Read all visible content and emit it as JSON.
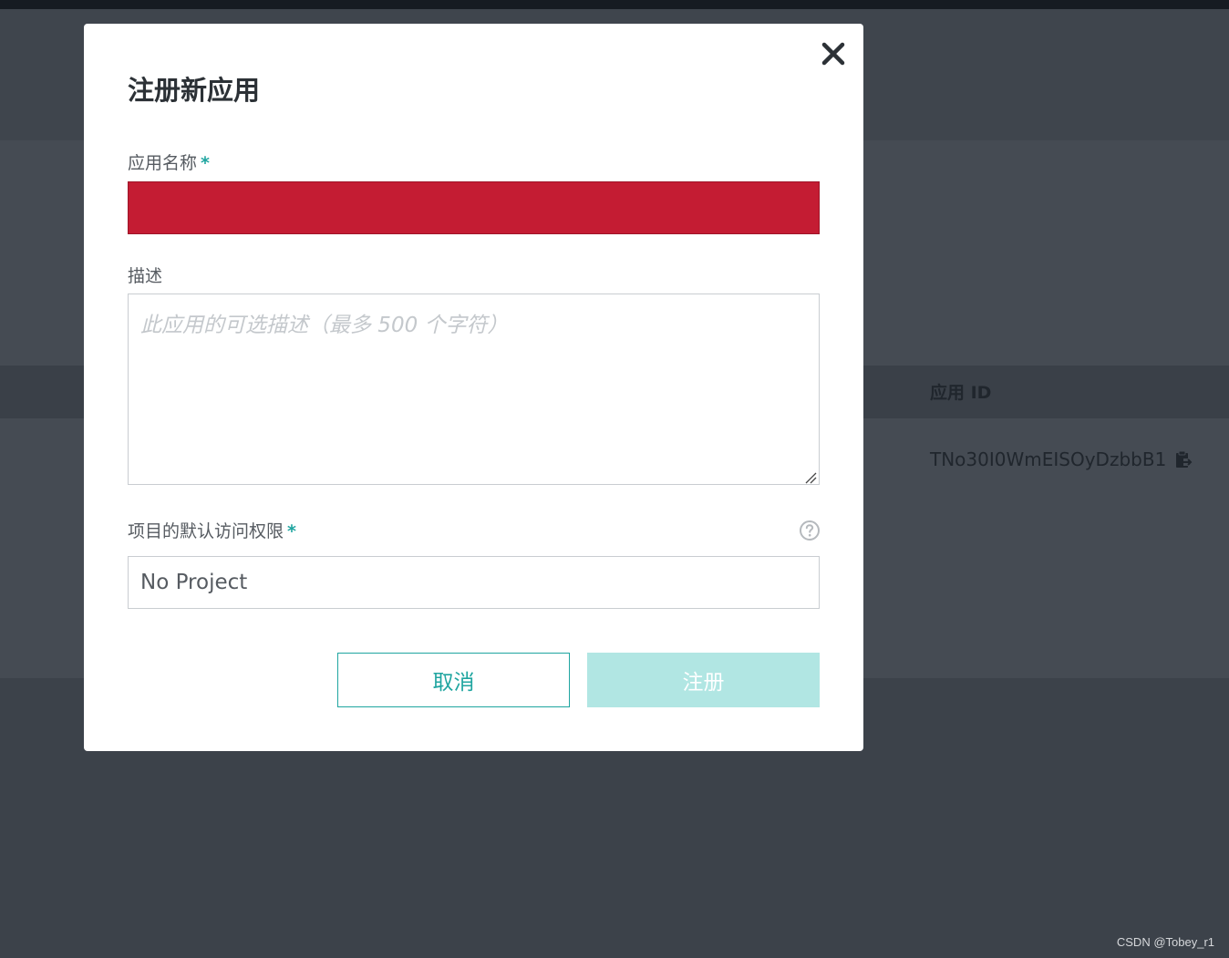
{
  "background": {
    "table_header_label": "应用 ID",
    "app_id_value": "TNo30I0WmEISOyDzbbB1",
    "copy_icon": "clipboard-icon",
    "watermark": "CSDN @Tobey_r1"
  },
  "modal": {
    "title": "注册新应用",
    "close_icon": "close-icon",
    "name_field": {
      "label": "应用名称",
      "required_mark": "*",
      "value": ""
    },
    "description_field": {
      "label": "描述",
      "placeholder": "此应用的可选描述（最多 500 个字符）",
      "value": ""
    },
    "project_access_field": {
      "label": "项目的默认访问权限",
      "required_mark": "*",
      "help_icon": "help-circle-icon",
      "selected": "No Project"
    },
    "buttons": {
      "cancel_label": "取消",
      "register_label": "注册"
    }
  },
  "colors": {
    "accent": "#1fa5a0",
    "error_field": "#c41c33",
    "register_disabled": "#b1e6e3",
    "backdrop": "#3c424a"
  }
}
